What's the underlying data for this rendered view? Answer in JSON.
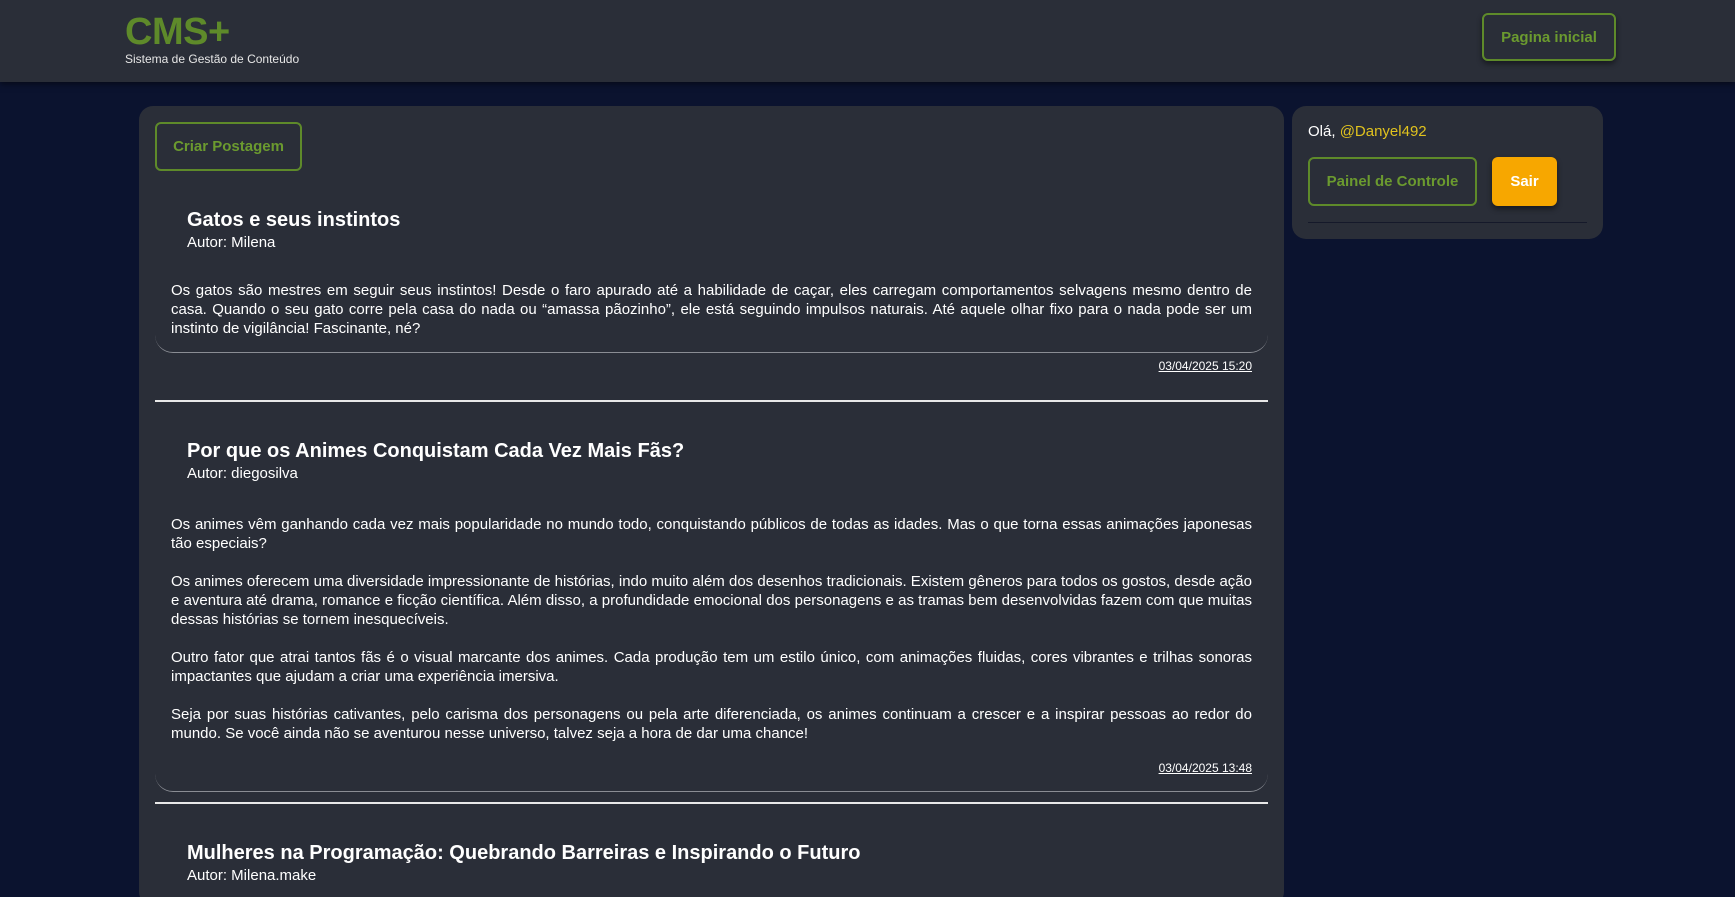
{
  "header": {
    "brand_title": "CMS+",
    "brand_subtitle": "Sistema de Gestão de Conteúdo",
    "home_label": "Pagina inicial"
  },
  "main": {
    "create_label": "Criar Postagem",
    "posts": [
      {
        "title": "Gatos e seus instintos",
        "author": "Autor: Milena",
        "paragraphs": [
          "Os gatos são mestres em seguir seus instintos! Desde o faro apurado até a habilidade de caçar, eles carregam comportamentos selvagens mesmo dentro de casa. Quando o seu gato corre pela casa do nada ou “amassa pãozinho”, ele está seguindo impulsos naturais. Até aquele olhar fixo para o nada pode ser um instinto de vigilância! Fascinante, né?"
        ],
        "date": "03/04/2025 15:20"
      },
      {
        "title": "Por que os Animes Conquistam Cada Vez Mais Fãs?",
        "author": "Autor: diegosilva",
        "paragraphs": [
          "Os animes vêm ganhando cada vez mais popularidade no mundo todo, conquistando públicos de todas as idades. Mas o que torna essas animações japonesas tão especiais?",
          "Os animes oferecem uma diversidade impressionante de histórias, indo muito além dos desenhos tradicionais. Existem gêneros para todos os gostos, desde ação e aventura até drama, romance e ficção científica. Além disso, a profundidade emocional dos personagens e as tramas bem desenvolvidas fazem com que muitas dessas histórias se tornem inesquecíveis.",
          "Outro fator que atrai tantos fãs é o visual marcante dos animes. Cada produção tem um estilo único, com animações fluidas, cores vibrantes e trilhas sonoras impactantes que ajudam a criar uma experiência imersiva.",
          "Seja por suas histórias cativantes, pelo carisma dos personagens ou pela arte diferenciada, os animes continuam a crescer e a inspirar pessoas ao redor do mundo. Se você ainda não se aventurou nesse universo, talvez seja a hora de dar uma chance!"
        ],
        "date": "03/04/2025 13:48"
      },
      {
        "title": "Mulheres na Programação: Quebrando Barreiras e Inspirando o Futuro",
        "author": "Autor: Milena.make"
      }
    ]
  },
  "sidebar": {
    "greeting_prefix": "Olá, ",
    "username": "@Danyel492",
    "panel_label": "Painel de Controle",
    "logout_label": "Sair"
  },
  "colors": {
    "page_background": "#0b132f",
    "panel_background": "#2a2e38",
    "accent_green": "#5e8a2a",
    "logout_orange": "#f7a700",
    "username_yellow": "#e0c21e"
  }
}
